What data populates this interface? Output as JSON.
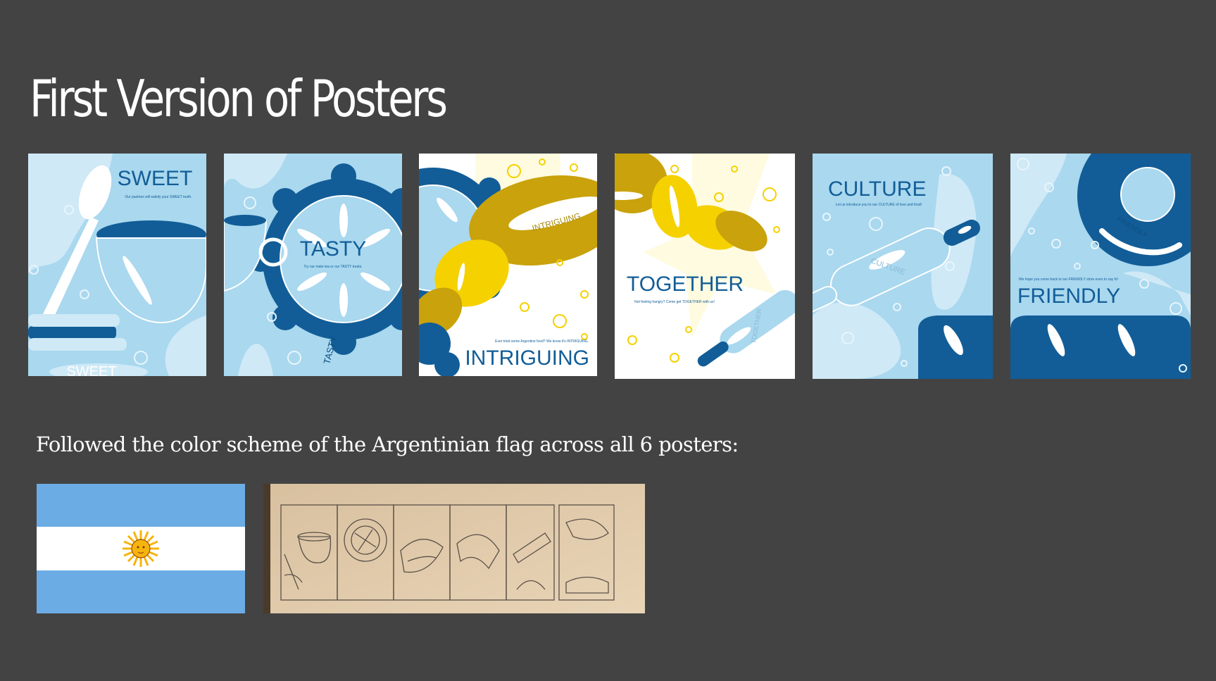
{
  "slide": {
    "title": "First Version of Posters",
    "caption": "Followed the color scheme of the Argentinian flag across all 6 posters:"
  },
  "posters": [
    {
      "headline": "SWEET",
      "body": "Our pastries will satisfy your SWEET tooth.",
      "echo": "SWEET"
    },
    {
      "headline": "TASTY",
      "body": "Try our mate tea or our TASTY treats.",
      "echo": "TASTY"
    },
    {
      "headline": "INTRIGUING",
      "body": "Ever tried some Argentine food? We know it's INTRIGUING.",
      "echo": "INTRIGUING"
    },
    {
      "headline": "TOGETHER",
      "body": "Not feeling hangry? Come get TOGETHER with us!",
      "echo": "TOGETHER"
    },
    {
      "headline": "CULTURE",
      "body": "Let us introduce you to our CULTURE of love and food!",
      "echo": "CULTURE"
    },
    {
      "headline": "FRIENDLY",
      "body": "We hope you come back to our FRIENDLY store even to say hi!",
      "echo": "FRIENDLY"
    }
  ],
  "colors": {
    "background": "#434343",
    "light_blue": "#a9d8ef",
    "pale_blue": "#cfe9f6",
    "dark_blue": "#125d97",
    "gold": "#c9a20c",
    "yellow": "#f5d100",
    "cream": "#fffbe0",
    "flag_blue": "#6cace4",
    "sun": "#f6b40e",
    "paper": "#e2cbaa"
  },
  "icons": {
    "flag": "argentina-flag",
    "sketch": "poster-thumbnail-sketches"
  }
}
